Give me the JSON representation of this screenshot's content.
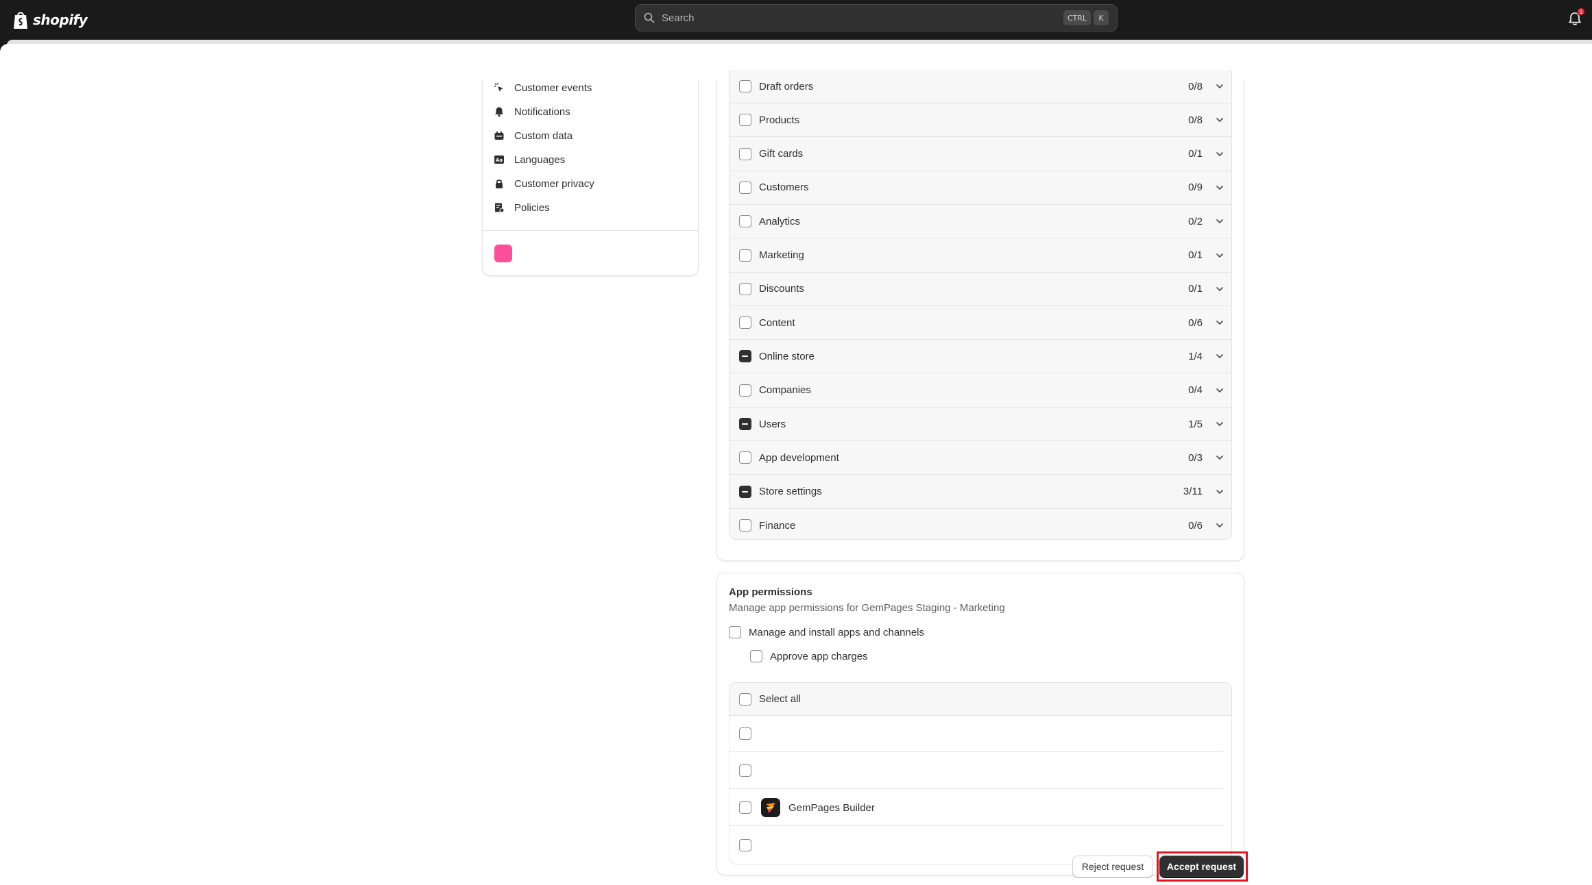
{
  "topbar": {
    "brand": "shopify",
    "search_placeholder": "Search",
    "shortcut_keys": [
      "CTRL",
      "K"
    ],
    "notification_count": "1"
  },
  "nav": {
    "items": [
      {
        "label": "Customer events",
        "icon": "cursor-click-icon"
      },
      {
        "label": "Notifications",
        "icon": "bell-icon"
      },
      {
        "label": "Custom data",
        "icon": "database-icon"
      },
      {
        "label": "Languages",
        "icon": "language-icon"
      },
      {
        "label": "Customer privacy",
        "icon": "lock-icon"
      },
      {
        "label": "Policies",
        "icon": "policy-icon"
      }
    ],
    "accent_color": "#ff4f9a"
  },
  "scopes": [
    {
      "label": "Draft orders",
      "count": "0/8",
      "state": "unchecked"
    },
    {
      "label": "Products",
      "count": "0/8",
      "state": "unchecked"
    },
    {
      "label": "Gift cards",
      "count": "0/1",
      "state": "unchecked"
    },
    {
      "label": "Customers",
      "count": "0/9",
      "state": "unchecked"
    },
    {
      "label": "Analytics",
      "count": "0/2",
      "state": "unchecked"
    },
    {
      "label": "Marketing",
      "count": "0/1",
      "state": "unchecked"
    },
    {
      "label": "Discounts",
      "count": "0/1",
      "state": "unchecked"
    },
    {
      "label": "Content",
      "count": "0/6",
      "state": "unchecked"
    },
    {
      "label": "Online store",
      "count": "1/4",
      "state": "indeterminate"
    },
    {
      "label": "Companies",
      "count": "0/4",
      "state": "unchecked"
    },
    {
      "label": "Users",
      "count": "1/5",
      "state": "indeterminate"
    },
    {
      "label": "App development",
      "count": "0/3",
      "state": "unchecked"
    },
    {
      "label": "Store settings",
      "count": "3/11",
      "state": "indeterminate"
    },
    {
      "label": "Finance",
      "count": "0/6",
      "state": "unchecked"
    }
  ],
  "app_permissions": {
    "title": "App permissions",
    "subtitle": "Manage app permissions for GemPages Staging - Marketing",
    "manage_label": "Manage and install apps and channels",
    "approve_label": "Approve app charges",
    "select_all_label": "Select all",
    "apps": [
      {
        "name": ""
      },
      {
        "name": ""
      },
      {
        "name": "GemPages Builder",
        "has_logo": true
      },
      {
        "name": ""
      }
    ]
  },
  "footer": {
    "reject_label": "Reject request",
    "accept_label": "Accept request"
  },
  "colors": {
    "topbar": "#1a1a1a",
    "primary_button": "#303030",
    "highlight": "#e0161f"
  }
}
